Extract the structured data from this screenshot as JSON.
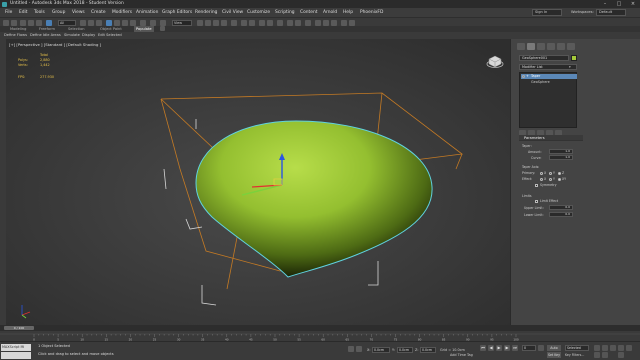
{
  "titlebar": {
    "title": "Untitled - Autodesk 3ds Max 2018 - Student Version",
    "minimize": "–",
    "maximize": "□",
    "close": "×"
  },
  "menubar": {
    "items": [
      "File",
      "Edit",
      "Tools",
      "Group",
      "Views",
      "Create",
      "Modifiers",
      "Animation",
      "Graph Editors",
      "Rendering",
      "Civil View",
      "Customize",
      "Scripting",
      "Content",
      "Arnold",
      "Help",
      "PhoenixFD"
    ],
    "signin": "Sign In",
    "workspaces_label": "Workspaces:",
    "workspace_value": "Default"
  },
  "toolbar": {
    "selection_filter": "All",
    "view_dropdown": "View"
  },
  "ribbon": {
    "tabs": [
      "Modeling",
      "Freeform",
      "Selection",
      "Object Paint",
      "Populate"
    ],
    "active_tab": "Populate",
    "sub_items": [
      "Define Flows",
      "Define Idle Areas",
      "Simulate",
      "Display",
      "Edit Selected"
    ]
  },
  "viewport": {
    "label": "[+] [Perspective ] [Standard ] [Default Shading ]",
    "stats": {
      "header": "Total",
      "rows": [
        {
          "k": "Polys:",
          "v": "2,880"
        },
        {
          "k": "Verts:",
          "v": "1,442"
        }
      ],
      "fps_label": "FPS:",
      "fps_value": "277.930"
    },
    "object_color": "#9bc23c"
  },
  "command_panel": {
    "object_name": "GeoSphere001",
    "modifier_list": "Modifier List",
    "stack": [
      "Taper",
      "GeoSphere"
    ],
    "selected_stack_index": 0,
    "rollout_title": "Parameters",
    "taper_label": "Taper:",
    "amount_label": "Amount:",
    "amount_value": "1.0",
    "curve_label": "Curve:",
    "curve_value": "1.0",
    "taper_axis_label": "Taper Axis:",
    "primary_label": "Primary:",
    "primary_options": [
      "X",
      "Y",
      "Z"
    ],
    "primary_selected": "Z",
    "effect_label": "Effect:",
    "effect_options": [
      "X",
      "Y",
      "XY"
    ],
    "effect_selected": "XY",
    "symmetry_label": "Symmetry",
    "limits_label": "Limits",
    "limit_effect_label": "Limit Effect",
    "upper_limit_label": "Upper Limit:",
    "upper_limit_value": "0.0",
    "lower_limit_label": "Lower Limit:",
    "lower_limit_value": "0.0"
  },
  "timeline": {
    "slider_label": "0 / 100"
  },
  "trackbar": {
    "ticks": [
      "0",
      "5",
      "10",
      "15",
      "20",
      "25",
      "30",
      "35",
      "40",
      "45",
      "50",
      "55",
      "60",
      "65",
      "70",
      "75",
      "80",
      "85",
      "90",
      "95",
      "100"
    ]
  },
  "statusbar": {
    "maxscript_label": "MAXScript Mi",
    "status_line1": "1 Object Selected",
    "status_line2": "Click and drag to select and move objects",
    "x_label": "X:",
    "x_value": "0.0cm",
    "y_label": "Y:",
    "y_value": "0.0cm",
    "z_label": "Z:",
    "z_value": "0.0cm",
    "grid_label": "Grid = 10.0cm",
    "add_time_tag": "Add Time Tag",
    "auto_key": "Auto Key",
    "set_key": "Set Key",
    "selected_value": "Selected",
    "key_filters": "Key Filters...",
    "frame_value": "0"
  }
}
